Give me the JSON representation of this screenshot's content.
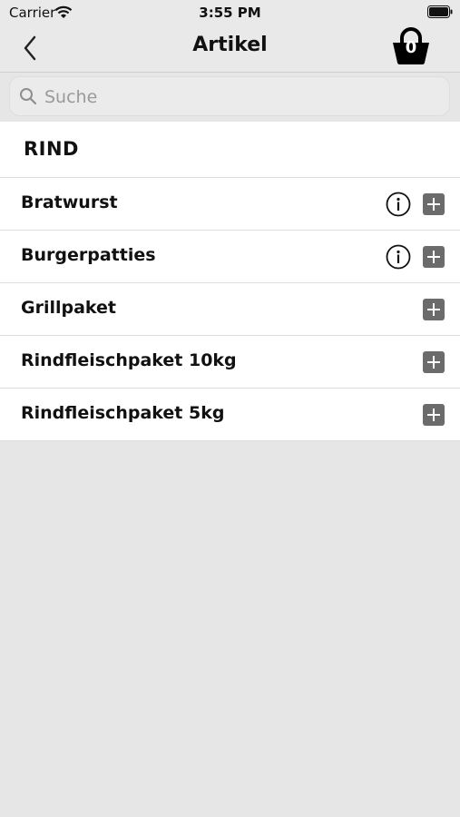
{
  "status_bar": {
    "carrier": "Carrier",
    "time": "3:55 PM"
  },
  "navbar": {
    "title": "Artikel",
    "cart_count": "0"
  },
  "search": {
    "placeholder": "Suche",
    "value": ""
  },
  "section": {
    "title": "RIND"
  },
  "items": [
    {
      "label": "Bratwurst",
      "has_info": true
    },
    {
      "label": "Burgerpatties",
      "has_info": true
    },
    {
      "label": "Grillpaket",
      "has_info": false
    },
    {
      "label": "Rindfleischpaket 10kg",
      "has_info": false
    },
    {
      "label": "Rindfleischpaket 5kg",
      "has_info": false
    }
  ],
  "colors": {
    "bar_background": "#e9e9e9",
    "add_button": "#6b6b6b",
    "list_background": "#ffffff"
  }
}
